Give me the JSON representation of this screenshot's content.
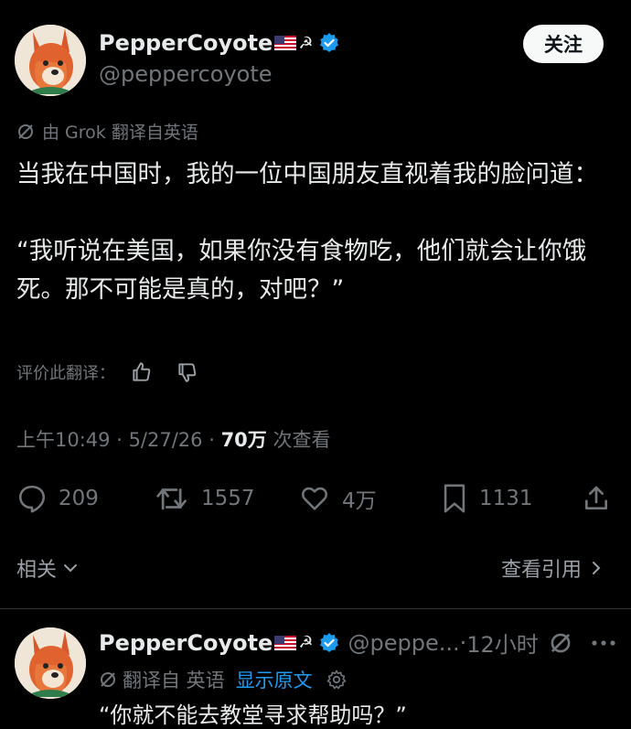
{
  "author": {
    "name": "PepperCoyote",
    "handle": "@peppercoyote",
    "sickle_symbol": "☭"
  },
  "follow_button_label": "关注",
  "translation_note": "由 Grok 翻译自英语",
  "tweet": {
    "paragraph_1": "当我在中国时，我的一位中国朋友直视着我的脸问道：",
    "paragraph_2": "“我听说在美国，如果你没有食物吃，他们就会让你饿死。那不可能是真的，对吧？”"
  },
  "rate_translation_label": "评价此翻译：",
  "meta": {
    "time": "上午10:49",
    "date": "5/27/26",
    "separator": " · ",
    "views_count": "70万",
    "views_label": " 次查看"
  },
  "actions": {
    "replies": "209",
    "retweets": "1557",
    "likes": "4万",
    "bookmarks": "1131"
  },
  "related_label": "相关",
  "view_quotes_label": "查看引用",
  "reply": {
    "name": "PepperCoyote",
    "handle_truncated": "@peppe...",
    "separator": " · ",
    "time": "12小时",
    "translated_from": "翻译自 英语",
    "show_original": "显示原文",
    "text_partial": "“你就不能去教堂寻求帮助吗？”"
  },
  "colors": {
    "background": "#000000",
    "text_primary": "#e7e9ea",
    "text_secondary": "#71767b",
    "verified_blue": "#1d9bf0",
    "button_bg": "#f7f9f9"
  }
}
